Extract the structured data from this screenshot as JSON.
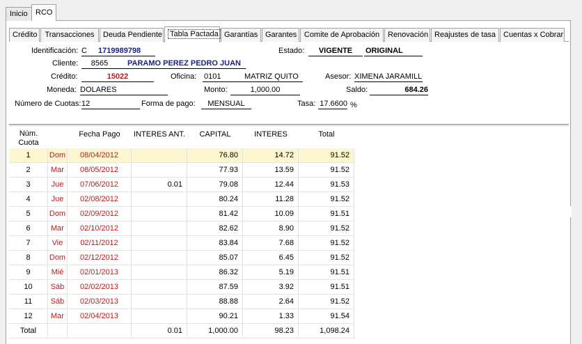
{
  "top_tabs": [
    {
      "label": "Inicio"
    },
    {
      "label": "RCO"
    }
  ],
  "sub_tabs": [
    {
      "label": "Crédito"
    },
    {
      "label": "Transacciones"
    },
    {
      "label": "Deuda Pendiente"
    },
    {
      "label": "Tabla Pactada"
    },
    {
      "label": "Garantías"
    },
    {
      "label": "Garantes"
    },
    {
      "label": "Comite de Aprobación"
    },
    {
      "label": "Renovación"
    },
    {
      "label": "Reajustes de tasa"
    },
    {
      "label": "Cuentas x Cobrar"
    }
  ],
  "form": {
    "identificacion_label": "Identificación:",
    "identificacion_tipo": "C",
    "identificacion_valor": "1719989798",
    "estado_label": "Estado:",
    "estado_valor": "VIGENTE",
    "estado_tipo": "ORIGINAL",
    "cliente_label": "Cliente:",
    "cliente_codigo": "8565",
    "cliente_nombre": "PARAMO PEREZ PEDRO JUAN",
    "credito_label": "Crédito:",
    "credito_valor": "15022",
    "oficina_label": "Oficina:",
    "oficina_codigo": "0101",
    "oficina_nombre": "MATRIZ QUITO",
    "asesor_label": "Asesor:",
    "asesor_valor": "XIMENA JARAMILLO",
    "moneda_label": "Moneda:",
    "moneda_valor": "DOLARES",
    "monto_label": "Monto:",
    "monto_valor": "1,000.00",
    "saldo_label": "Saldo:",
    "saldo_valor": "684.26",
    "cuotas_label": "Número de Cuotas:",
    "cuotas_valor": "12",
    "forma_pago_label": "Forma de pago:",
    "forma_pago_valor": "MENSUAL",
    "tasa_label": "Tasa:",
    "tasa_valor": "17.6600",
    "tasa_unidad": "%"
  },
  "table": {
    "headers": [
      "Núm.\nCuota",
      "",
      "Fecha Pago",
      "INTERES ANT.",
      "CAPITAL",
      "INTERES",
      "Total"
    ],
    "rows": [
      {
        "num": "1",
        "dia": "Dom",
        "fecha": "08/04/2012",
        "int_ant": "",
        "capital": "76.80",
        "interes": "14.72",
        "total": "91.52"
      },
      {
        "num": "2",
        "dia": "Mar",
        "fecha": "08/05/2012",
        "int_ant": "",
        "capital": "77.93",
        "interes": "13.59",
        "total": "91.52"
      },
      {
        "num": "3",
        "dia": "Jue",
        "fecha": "07/06/2012",
        "int_ant": "0.01",
        "capital": "79.08",
        "interes": "12.44",
        "total": "91.53"
      },
      {
        "num": "4",
        "dia": "Jue",
        "fecha": "02/08/2012",
        "int_ant": "",
        "capital": "80.24",
        "interes": "11.28",
        "total": "91.52"
      },
      {
        "num": "5",
        "dia": "Dom",
        "fecha": "02/09/2012",
        "int_ant": "",
        "capital": "81.42",
        "interes": "10.09",
        "total": "91.51"
      },
      {
        "num": "6",
        "dia": "Mar",
        "fecha": "02/10/2012",
        "int_ant": "",
        "capital": "82.62",
        "interes": "8.90",
        "total": "91.52"
      },
      {
        "num": "7",
        "dia": "Vie",
        "fecha": "02/11/2012",
        "int_ant": "",
        "capital": "83.84",
        "interes": "7.68",
        "total": "91.52"
      },
      {
        "num": "8",
        "dia": "Dom",
        "fecha": "02/12/2012",
        "int_ant": "",
        "capital": "85.07",
        "interes": "6.45",
        "total": "91.52"
      },
      {
        "num": "9",
        "dia": "Mié",
        "fecha": "02/01/2013",
        "int_ant": "",
        "capital": "86.32",
        "interes": "5.19",
        "total": "91.51"
      },
      {
        "num": "10",
        "dia": "Sáb",
        "fecha": "02/02/2013",
        "int_ant": "",
        "capital": "87.59",
        "interes": "3.92",
        "total": "91.51"
      },
      {
        "num": "11",
        "dia": "Sáb",
        "fecha": "02/03/2013",
        "int_ant": "",
        "capital": "88.88",
        "interes": "2.64",
        "total": "91.52"
      },
      {
        "num": "12",
        "dia": "Mar",
        "fecha": "02/04/2013",
        "int_ant": "",
        "capital": "90.21",
        "interes": "1.33",
        "total": "91.54"
      }
    ],
    "totals": {
      "label": "Total",
      "int_ant": "0.01",
      "capital": "1,000.00",
      "interes": "98.23",
      "total": "1,098.24"
    }
  }
}
